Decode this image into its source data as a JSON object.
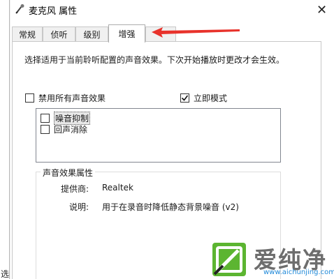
{
  "background_edge_text": "选",
  "window": {
    "title": "麦克风 属性",
    "close_glyph": "✕"
  },
  "tabs": [
    {
      "label": "常规"
    },
    {
      "label": "侦听"
    },
    {
      "label": "级别"
    },
    {
      "label": "增强",
      "active": true
    },
    {
      "label": ""
    }
  ],
  "enhancements": {
    "description": "选择适用于当前聆听配置的声音效果。下次开始播放时更改才会生效。",
    "disable_all": {
      "label": "禁用所有声音效果",
      "checked": false
    },
    "immediate_mode": {
      "label": "立即模式",
      "checked": true
    },
    "effects": [
      {
        "label": "噪音抑制",
        "checked": false,
        "selected": true
      },
      {
        "label": "回声消除",
        "checked": false,
        "selected": false
      }
    ]
  },
  "properties": {
    "group_title": "声音效果属性",
    "provider_label": "提供商:",
    "provider_value": "Realtek",
    "description_label": "说明:",
    "description_value": "用于在录音时降低静态背景噪音 (v2)"
  },
  "watermark": {
    "text": "爱纯净",
    "url": "www.aichunjing.com"
  },
  "colors": {
    "annotation_arrow": "#e8322b",
    "watermark_green": "#5cb531"
  }
}
